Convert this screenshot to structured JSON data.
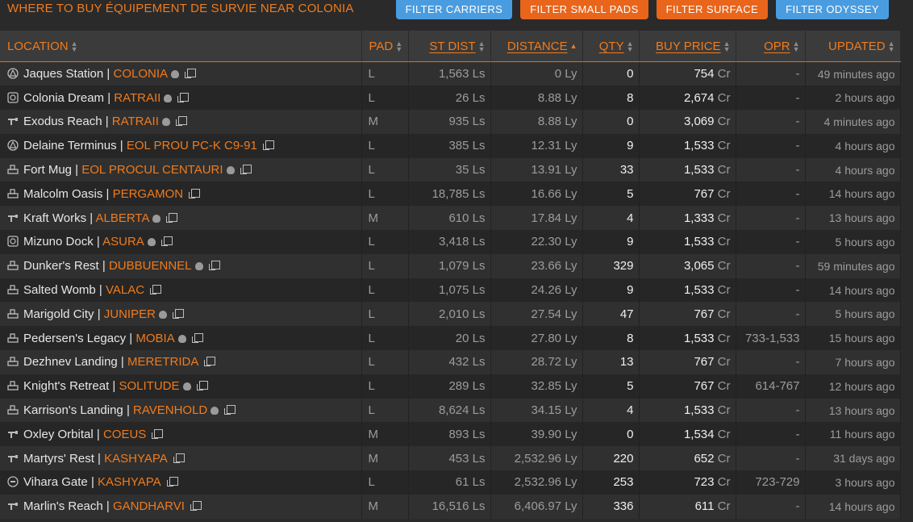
{
  "title": "WHERE TO BUY ÉQUIPEMENT DE SURVIE NEAR COLONIA",
  "filters": [
    "FILTER CARRIERS",
    "FILTER SMALL PADS",
    "FILTER SURFACE",
    "FILTER ODYSSEY"
  ],
  "filter_colors": [
    "#4a9ce0",
    "#e8651b",
    "#e8651b",
    "#4a9ce0"
  ],
  "columns": {
    "location": "LOCATION",
    "pad": "PAD",
    "st_dist": "ST DIST",
    "distance": "DISTANCE",
    "qty": "QTY",
    "buy_price": "BUY PRICE",
    "opr": "OPR",
    "updated": "UPDATED"
  },
  "units": {
    "ls": "Ls",
    "ly": "Ly",
    "cr": "Cr"
  },
  "rows": [
    {
      "icon": "coriolis-icon",
      "station": "Jaques Station",
      "system": "COLONIA",
      "skull": true,
      "pad": "L",
      "st_dist": "1,563",
      "distance": "0",
      "qty": "0",
      "price": "754",
      "opr": "-",
      "updated": "49 minutes ago"
    },
    {
      "icon": "orbis-icon",
      "station": "Colonia Dream",
      "system": "RATRAII",
      "skull": true,
      "pad": "L",
      "st_dist": "26",
      "distance": "8.88",
      "qty": "8",
      "price": "2,674",
      "opr": "-",
      "updated": "2 hours ago"
    },
    {
      "icon": "outpost-icon",
      "station": "Exodus Reach",
      "system": "RATRAII",
      "skull": true,
      "pad": "M",
      "st_dist": "935",
      "distance": "8.88",
      "qty": "0",
      "price": "3,069",
      "opr": "-",
      "updated": "4 minutes ago"
    },
    {
      "icon": "coriolis-icon",
      "station": "Delaine Terminus",
      "system": "EOL PROU PC-K C9-91",
      "skull": false,
      "pad": "L",
      "st_dist": "385",
      "distance": "12.31",
      "qty": "9",
      "price": "1,533",
      "opr": "-",
      "updated": "4 hours ago"
    },
    {
      "icon": "planetary-icon",
      "station": "Fort Mug",
      "system": "EOL PROCUL CENTAURI",
      "skull": true,
      "pad": "L",
      "st_dist": "35",
      "distance": "13.91",
      "qty": "33",
      "price": "1,533",
      "opr": "-",
      "updated": "4 hours ago"
    },
    {
      "icon": "planetary-icon",
      "station": "Malcolm Oasis",
      "system": "PERGAMON",
      "skull": false,
      "pad": "L",
      "st_dist": "18,785",
      "distance": "16.66",
      "qty": "5",
      "price": "767",
      "opr": "-",
      "updated": "14 hours ago"
    },
    {
      "icon": "outpost-icon",
      "station": "Kraft Works",
      "system": "ALBERTA",
      "skull": true,
      "pad": "M",
      "st_dist": "610",
      "distance": "17.84",
      "qty": "4",
      "price": "1,333",
      "opr": "-",
      "updated": "13 hours ago"
    },
    {
      "icon": "orbis-icon",
      "station": "Mizuno Dock",
      "system": "ASURA",
      "skull": true,
      "pad": "L",
      "st_dist": "3,418",
      "distance": "22.30",
      "qty": "9",
      "price": "1,533",
      "opr": "-",
      "updated": "5 hours ago"
    },
    {
      "icon": "planetary-icon",
      "station": "Dunker's Rest",
      "system": "DUBBUENNEL",
      "skull": true,
      "pad": "L",
      "st_dist": "1,079",
      "distance": "23.66",
      "qty": "329",
      "price": "3,065",
      "opr": "-",
      "updated": "59 minutes ago"
    },
    {
      "icon": "planetary-icon",
      "station": "Salted Womb",
      "system": "VALAC",
      "skull": false,
      "pad": "L",
      "st_dist": "1,075",
      "distance": "24.26",
      "qty": "9",
      "price": "1,533",
      "opr": "-",
      "updated": "14 hours ago"
    },
    {
      "icon": "planetary-icon",
      "station": "Marigold City",
      "system": "JUNIPER",
      "skull": true,
      "pad": "L",
      "st_dist": "2,010",
      "distance": "27.54",
      "qty": "47",
      "price": "767",
      "opr": "-",
      "updated": "5 hours ago"
    },
    {
      "icon": "planetary-icon",
      "station": "Pedersen's Legacy",
      "system": "MOBIA",
      "skull": true,
      "pad": "L",
      "st_dist": "20",
      "distance": "27.80",
      "qty": "8",
      "price": "1,533",
      "opr": "733-1,533",
      "updated": "15 hours ago"
    },
    {
      "icon": "planetary-icon",
      "station": "Dezhnev Landing",
      "system": "MERETRIDA",
      "skull": false,
      "pad": "L",
      "st_dist": "432",
      "distance": "28.72",
      "qty": "13",
      "price": "767",
      "opr": "-",
      "updated": "7 hours ago"
    },
    {
      "icon": "planetary-icon",
      "station": "Knight's Retreat",
      "system": "SOLITUDE",
      "skull": true,
      "pad": "L",
      "st_dist": "289",
      "distance": "32.85",
      "qty": "5",
      "price": "767",
      "opr": "614-767",
      "updated": "12 hours ago"
    },
    {
      "icon": "planetary-icon",
      "station": "Karrison's Landing",
      "system": "RAVENHOLD",
      "skull": true,
      "pad": "L",
      "st_dist": "8,624",
      "distance": "34.15",
      "qty": "4",
      "price": "1,533",
      "opr": "-",
      "updated": "13 hours ago"
    },
    {
      "icon": "outpost-icon",
      "station": "Oxley Orbital",
      "system": "COEUS",
      "skull": false,
      "pad": "M",
      "st_dist": "893",
      "distance": "39.90",
      "qty": "0",
      "price": "1,534",
      "opr": "-",
      "updated": "11 hours ago"
    },
    {
      "icon": "outpost-icon",
      "station": "Martyrs' Rest",
      "system": "KASHYAPA",
      "skull": false,
      "pad": "M",
      "st_dist": "453",
      "distance": "2,532.96",
      "qty": "220",
      "price": "652",
      "opr": "-",
      "updated": "31 days ago"
    },
    {
      "icon": "ocellus-icon",
      "station": "Vihara Gate",
      "system": "KASHYAPA",
      "skull": false,
      "pad": "L",
      "st_dist": "61",
      "distance": "2,532.96",
      "qty": "253",
      "price": "723",
      "opr": "723-729",
      "updated": "3 hours ago"
    },
    {
      "icon": "outpost-icon",
      "station": "Marlin's Reach",
      "system": "GANDHARVI",
      "skull": false,
      "pad": "M",
      "st_dist": "16,516",
      "distance": "6,406.97",
      "qty": "336",
      "price": "611",
      "opr": "-",
      "updated": "14 hours ago"
    }
  ]
}
